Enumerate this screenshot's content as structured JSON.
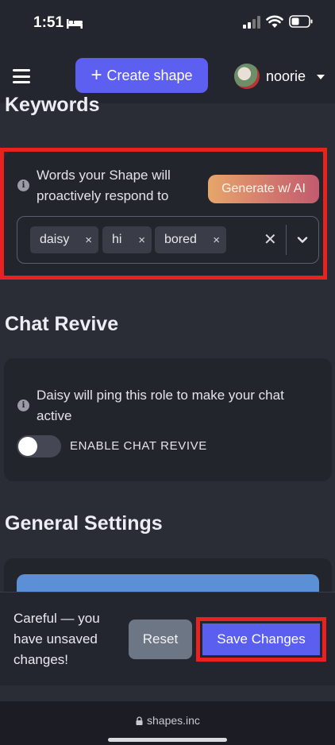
{
  "status_bar": {
    "time": "1:51"
  },
  "header": {
    "create_label": "Create shape",
    "username": "noorie"
  },
  "keywords": {
    "title": "Keywords",
    "description": "Words your Shape will proactively respond to",
    "generate_label": "Generate w/ AI",
    "chips": [
      "daisy",
      "hi",
      "bored"
    ]
  },
  "chat_revive": {
    "title": "Chat Revive",
    "description": "Daisy will ping this role to make your chat active",
    "toggle_label": "ENABLE CHAT REVIVE",
    "enabled": false
  },
  "general": {
    "title": "General Settings"
  },
  "save_bar": {
    "message": "Careful — you have unsaved changes!",
    "reset_label": "Reset",
    "save_label": "Save Changes"
  },
  "browser": {
    "url": "shapes.inc"
  },
  "colors": {
    "accent": "#5d5ff0",
    "highlight": "#e8231f",
    "background": "#2a2c36"
  }
}
